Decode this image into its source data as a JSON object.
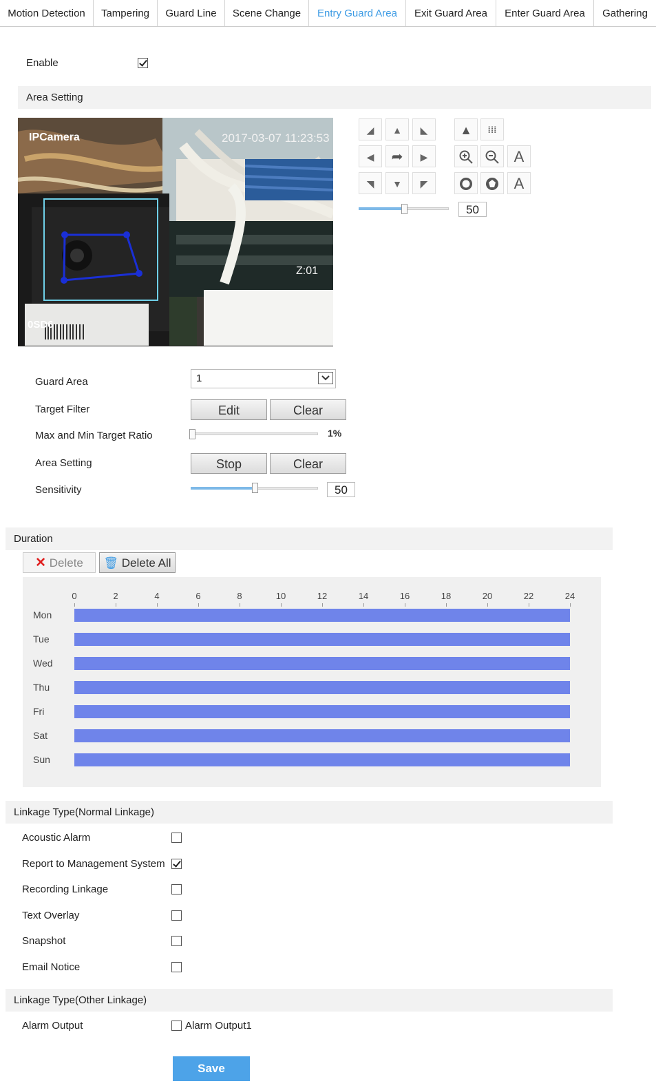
{
  "tabs": [
    {
      "label": "Motion Detection",
      "active": false
    },
    {
      "label": "Tampering",
      "active": false
    },
    {
      "label": "Guard Line",
      "active": false
    },
    {
      "label": "Scene Change",
      "active": false
    },
    {
      "label": "Entry Guard Area",
      "active": true
    },
    {
      "label": "Exit Guard Area",
      "active": false
    },
    {
      "label": "Enter Guard Area",
      "active": false
    },
    {
      "label": "Gathering",
      "active": false
    }
  ],
  "enable": {
    "label": "Enable",
    "checked": true
  },
  "area_setting_header": "Area Setting",
  "preview": {
    "camera_name": "IPCamera",
    "timestamp": "2017-03-07 11:23:53",
    "zoom_label": "Z:01",
    "osd_code": "0SD6"
  },
  "ptz": {
    "speed_value": "50",
    "speed_level": 0.5,
    "text_glyph_1": "A",
    "text_glyph_2": "A"
  },
  "form": {
    "guard_area_label": "Guard Area",
    "guard_area_value": "1",
    "target_filter_label": "Target Filter",
    "edit_button": "Edit",
    "clear_button": "Clear",
    "ratio_label": "Max and Min Target Ratio",
    "ratio_value": "1%",
    "ratio_level": 0.01,
    "area_setting_label": "Area Setting",
    "stop_button": "Stop",
    "clear_button_2": "Clear",
    "sensitivity_label": "Sensitivity",
    "sensitivity_value": "50",
    "sensitivity_level": 0.5
  },
  "duration": {
    "header": "Duration",
    "delete_button": "Delete",
    "delete_all_button": "Delete All",
    "hour_ticks": [
      "0",
      "2",
      "4",
      "6",
      "8",
      "10",
      "12",
      "14",
      "16",
      "18",
      "20",
      "22",
      "24"
    ],
    "days": [
      {
        "name": "Mon",
        "start": 0,
        "end": 24
      },
      {
        "name": "Tue",
        "start": 0,
        "end": 24
      },
      {
        "name": "Wed",
        "start": 0,
        "end": 24
      },
      {
        "name": "Thu",
        "start": 0,
        "end": 24
      },
      {
        "name": "Fri",
        "start": 0,
        "end": 24
      },
      {
        "name": "Sat",
        "start": 0,
        "end": 24
      },
      {
        "name": "Sun",
        "start": 0,
        "end": 24
      }
    ],
    "bar_color": "#6f84ea"
  },
  "linkage_normal": {
    "header": "Linkage Type(Normal Linkage)",
    "items": [
      {
        "label": "Acoustic Alarm",
        "checked": false
      },
      {
        "label": "Report to Management System",
        "checked": true
      },
      {
        "label": "Recording Linkage",
        "checked": false
      },
      {
        "label": "Text Overlay",
        "checked": false
      },
      {
        "label": "Snapshot",
        "checked": false
      },
      {
        "label": "Email Notice",
        "checked": false
      }
    ]
  },
  "linkage_other": {
    "header": "Linkage Type(Other Linkage)",
    "alarm_output_label": "Alarm Output",
    "alarm_output_option": "Alarm Output1",
    "alarm_output_checked": false
  },
  "save_button": "Save",
  "colors": {
    "accent": "#3d9be4",
    "save": "#4da3e8",
    "area_box": "#6fd0e8",
    "polygon": "#1a2fd6"
  }
}
